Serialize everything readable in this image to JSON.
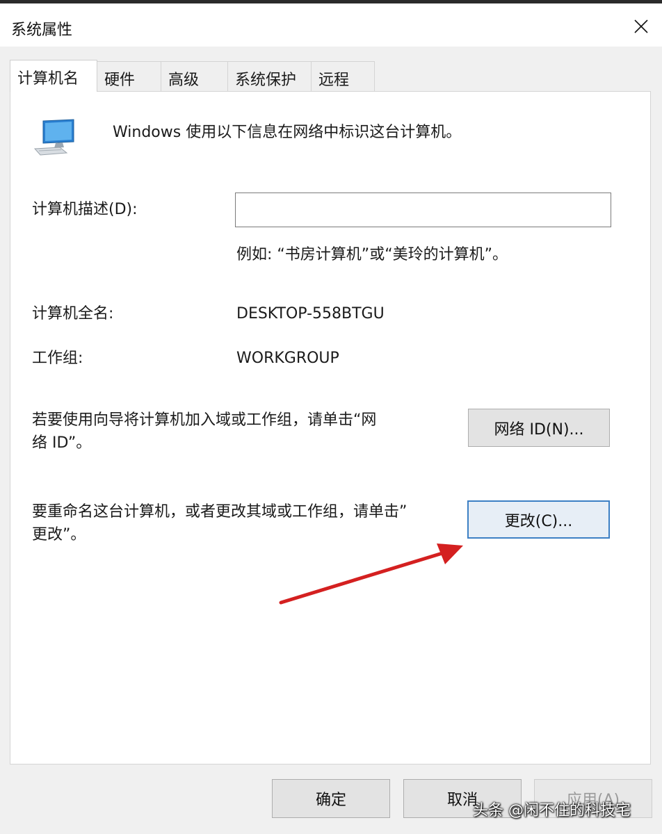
{
  "window": {
    "title": "系统属性",
    "close_icon": "close-icon"
  },
  "tabs": [
    {
      "label": "计算机名",
      "active": true
    },
    {
      "label": "硬件",
      "active": false
    },
    {
      "label": "高级",
      "active": false
    },
    {
      "label": "系统保护",
      "active": false
    },
    {
      "label": "远程",
      "active": false
    }
  ],
  "computer_name": {
    "icon": "monitor-icon",
    "intro": "Windows 使用以下信息在网络中标识这台计算机。",
    "description_label": "计算机描述(D):",
    "description_value": "",
    "description_example": "例如: “书房计算机”或“美玲的计算机”。",
    "full_name_label": "计算机全名:",
    "full_name_value": "DESKTOP-558BTGU",
    "workgroup_label": "工作组:",
    "workgroup_value": "WORKGROUP",
    "network_id_text_line1": "若要使用向导将计算机加入域或工作组，请单击“网",
    "network_id_text_line2": "络 ID”。",
    "network_id_button": "网络 ID(N)...",
    "rename_text_line1": "要重命名这台计算机，或者更改其域或工作组，请单击”",
    "rename_text_line2": "更改”。",
    "change_button": "更改(C)..."
  },
  "footer": {
    "ok_button": "确定",
    "cancel_button": "取消",
    "apply_button": "应用(A)"
  },
  "annotation": {
    "arrow_color": "#d42020"
  },
  "watermark": "头条 @闲不住的科技宅"
}
